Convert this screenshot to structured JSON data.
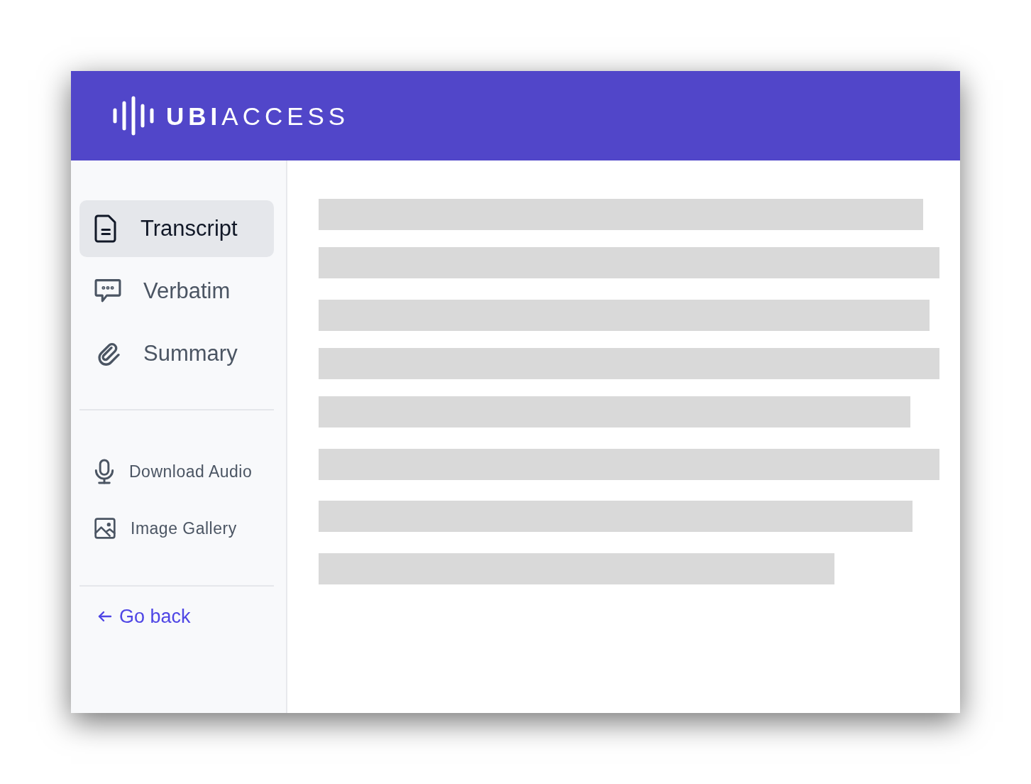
{
  "header": {
    "logo": "**UBI**ACCESS"
  },
  "nav": [
    {
      "label": "Transcript",
      "selected": true
    },
    {
      "label": "Verbatim",
      "selected": false
    },
    {
      "label": "Summary",
      "selected": false
    }
  ],
  "tools": [
    {
      "label": "Download Audio"
    },
    {
      "label": "Image Gallery"
    }
  ],
  "back_link": {
    "label": "Go back"
  }
}
